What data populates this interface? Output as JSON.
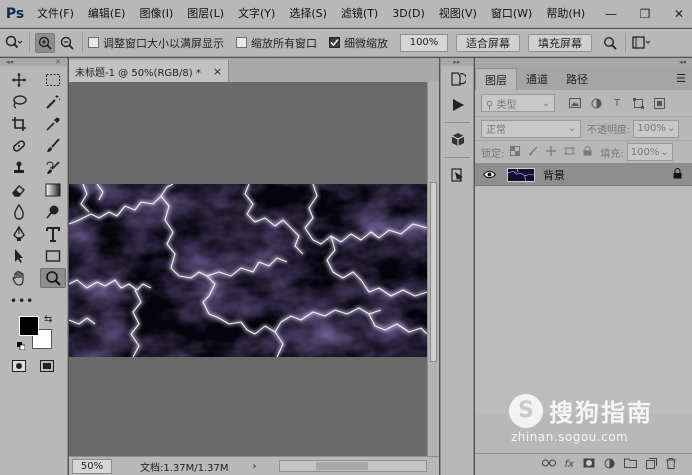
{
  "app": {
    "logo": "Ps"
  },
  "menu": [
    "文件(F)",
    "编辑(E)",
    "图像(I)",
    "图层(L)",
    "文字(Y)",
    "选择(S)",
    "滤镜(T)",
    "3D(D)",
    "视图(V)",
    "窗口(W)",
    "帮助(H)"
  ],
  "window_controls": {
    "minimize": "—",
    "restore": "❐",
    "close": "✕"
  },
  "options": {
    "check_resize": "调整窗口大小以满屏显示",
    "check_zoom_all": "缩放所有窗口",
    "check_scrubby": "细微缩放",
    "zoom_value": "100%",
    "fit_screen": "适合屏幕",
    "fill_screen": "填充屏幕"
  },
  "document": {
    "tab_title": "未标题-1 @ 50%(RGB/8) *",
    "tab_close": "×",
    "zoom": "50%",
    "doc_info": "文档:1.37M/1.37M"
  },
  "layers_panel": {
    "tabs": [
      "图层",
      "通道",
      "路径"
    ],
    "filter_kind": "类型",
    "blend_mode": "正常",
    "opacity_label": "不透明度:",
    "opacity_value": "100%",
    "lock_label": "锁定:",
    "fill_label": "填充:",
    "fill_value": "100%",
    "layers": [
      {
        "name": "背景",
        "visible": true,
        "locked": true
      }
    ],
    "bottom_icons": [
      "link-icon",
      "fx-icon",
      "mask-icon",
      "adjustment-icon",
      "folder-icon",
      "new-layer-icon",
      "trash-icon"
    ],
    "fx_label": "fx"
  },
  "watermark": {
    "brand": "搜狗指南",
    "url": "zhinan.sogou.com",
    "logo_letter": "S"
  },
  "colors": {
    "chrome": "#b8b8b8",
    "canvas_bg": "#6a6a6a",
    "lightning_glow": "#b7a8ff"
  }
}
